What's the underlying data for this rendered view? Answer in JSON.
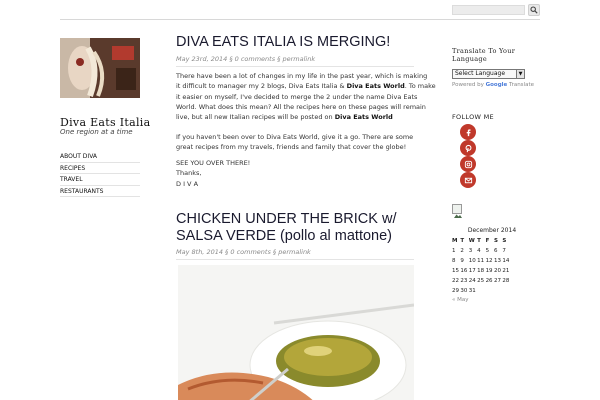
{
  "search": {
    "placeholder": ""
  },
  "sidebar": {
    "site_title": "Diva Eats Italia",
    "tagline": "One region at a time",
    "nav": [
      "ABOUT DIVA",
      "RECIPES",
      "TRAVEL",
      "RESTAURANTS"
    ]
  },
  "posts": [
    {
      "title": "DIVA EATS ITALIA IS MERGING!",
      "meta": "May 23rd, 2014 § 0 comments § permalink",
      "paragraphs": [
        {
          "lines": [
            "There have been a lot of changes in my life in the past year, which is making",
            "it difficult to manager my 2 blogs, Diva Eats Italia & ",
            "it easier on myself, I've decided to merge the 2 under the name Diva Eats",
            "World. What does this mean? All the recipes here on these pages will remain",
            "live, but all new Italian recipes will be posted on "
          ],
          "bold_1": "Diva Eats World",
          "line2_tail": ". To make",
          "bold_2": "Diva Eats World"
        },
        {
          "lines": [
            "If you haven't been over to Diva Eats World, give it a go. There are some",
            "great recipes from my travels, friends and family that cover the globe!"
          ]
        },
        {
          "lines": [
            "SEE YOU OVER THERE!",
            "Thanks,",
            "D I V A"
          ]
        }
      ]
    },
    {
      "title_lines": [
        "CHICKEN UNDER THE BRICK w/",
        "SALSA VERDE (pollo al mattone)"
      ],
      "meta": "May 8th, 2014 § 0 comments § permalink"
    }
  ],
  "right": {
    "translate_heading_lines": [
      "Translate To Your",
      "Language"
    ],
    "select_value": "Select Language",
    "powered_prefix": "Powered by ",
    "powered_google": "Google",
    "powered_suffix": " Translate",
    "follow_heading": "FOLLOW ME",
    "social_icons": [
      "facebook-icon",
      "pinterest-icon",
      "instagram-icon",
      "email-icon"
    ],
    "social_color": "#c0392b"
  },
  "calendar": {
    "caption": "December 2014",
    "days": [
      "M",
      "T",
      "W",
      "T",
      "F",
      "S",
      "S"
    ],
    "weeks": [
      [
        "1",
        "2",
        "3",
        "4",
        "5",
        "6",
        "7"
      ],
      [
        "8",
        "9",
        "10",
        "11",
        "12",
        "13",
        "14"
      ],
      [
        "15",
        "16",
        "17",
        "18",
        "19",
        "20",
        "21"
      ],
      [
        "22",
        "23",
        "24",
        "25",
        "26",
        "27",
        "28"
      ],
      [
        "29",
        "30",
        "31",
        "",
        "",
        "",
        ""
      ]
    ],
    "prev": "« May"
  }
}
